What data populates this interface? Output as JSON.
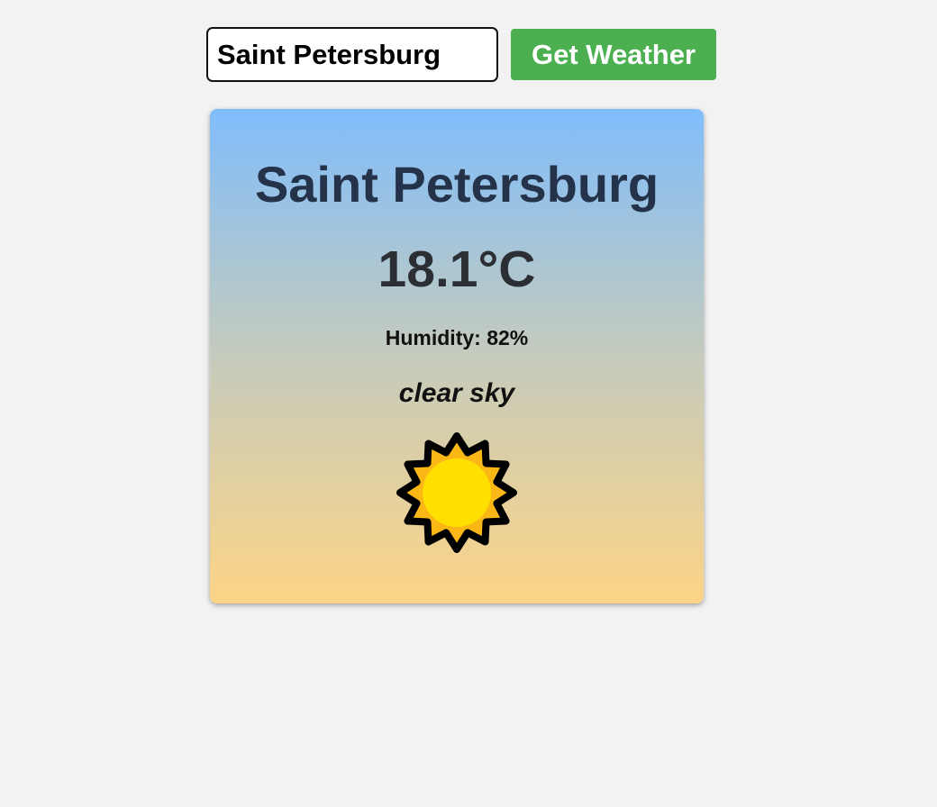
{
  "search": {
    "value": "Saint Petersburg",
    "button_label": "Get Weather"
  },
  "weather": {
    "city": "Saint Petersburg",
    "temperature": "18.1°C",
    "humidity": "Humidity: 82%",
    "description": "clear sky",
    "icon": "sun-icon"
  },
  "colors": {
    "button": "#4caf50",
    "card_gradient_top": "#80bdfb",
    "card_gradient_bottom": "#fdd486",
    "sun_core": "#ffdf00",
    "sun_rays": "#fbb716"
  }
}
